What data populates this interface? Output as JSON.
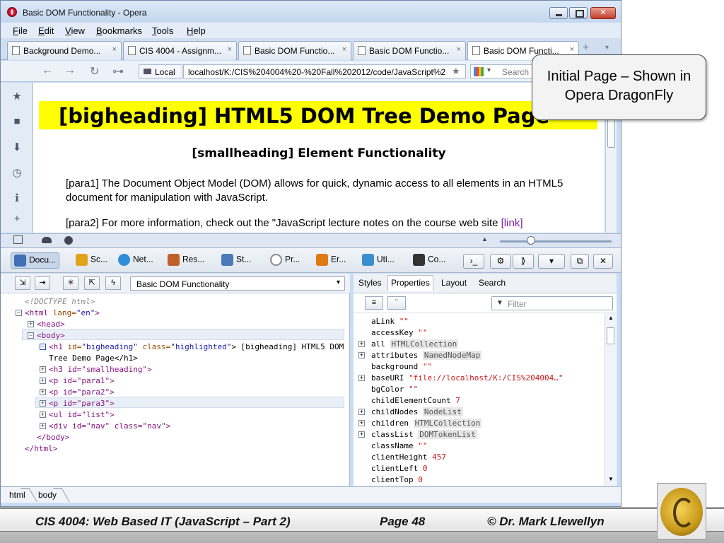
{
  "window": {
    "title": "Basic DOM Functionality - Opera",
    "close_glyph": "✕"
  },
  "menu": [
    "File",
    "Edit",
    "View",
    "Bookmarks",
    "Tools",
    "Help"
  ],
  "tabs": [
    {
      "label": "Background Demo...",
      "close": "×"
    },
    {
      "label": "CIS 4004 - Assignm...",
      "close": "×"
    },
    {
      "label": "Basic DOM Functio...",
      "close": "×"
    },
    {
      "label": "Basic DOM Functio...",
      "close": "×"
    },
    {
      "label": "Basic DOM Functi...",
      "close": "×"
    }
  ],
  "tab_add": "+",
  "tab_menu": "▾",
  "address": {
    "back": "←",
    "forward": "→",
    "reload": "↻",
    "key": "⊶",
    "local_label": "Local",
    "url": "localhost/K:/CIS%204004%20-%20Fall%202012/code/JavaScript%2",
    "star": "★",
    "search_placeholder": "Search",
    "search_arrow": "▾"
  },
  "sidepanel_icons": [
    "★",
    "■",
    "⬇",
    "◷",
    "ℹ",
    "+"
  ],
  "page": {
    "bigheading": "[bigheading] HTML5 DOM Tree Demo Page",
    "smallheading": "[smallheading] Element Functionality",
    "para1": "[para1] The Document Object Model (DOM) allows for quick, dynamic access to all elements in an HTML5 document for manipulation with JavaScript.",
    "para2_text": "[para2] For more information, check out the \"JavaScript lecture notes on the course web site ",
    "para2_link": "[link]"
  },
  "dragonfly": {
    "tabs": [
      "Docu...",
      "Sc...",
      "Net...",
      "Res...",
      "St...",
      "Pr...",
      "Er...",
      "Uti...",
      "Co..."
    ],
    "tab_colors": [
      "#3f6fb5",
      "#e2a21a",
      "#2e8ed8",
      "#c0602a",
      "#4a7ab8",
      "#8a8a8a",
      "#e07a10",
      "#3a8fd0",
      "#333333"
    ],
    "toolbar_buttons": [
      "›_",
      "⚙",
      "⟫",
      "▾",
      "⧉",
      "✕"
    ],
    "dom_select": "Basic DOM Functionality",
    "dom_buttons": [
      "⇲",
      "⇥",
      "✳",
      "⇱",
      "ϟ"
    ],
    "tree": {
      "doctype": "<!DOCTYPE html>",
      "html_open": "<html",
      "lang_attr": " lang=",
      "lang_val": "\"en\"",
      "head": "<head>",
      "body": "<body>",
      "h1_open": "<h1",
      "h1_id": " id=",
      "h1_id_val": "\"bigheading\"",
      "h1_class": " class=",
      "h1_class_val": "\"highlighted\"",
      "h1_text1": "> [bigheading] HTML5 DOM",
      "h1_text2": "Tree Demo Page</h1>",
      "h3": "<h3 id=\"smallheading\">",
      "p1": "<p id=\"para1\">",
      "p2": "<p id=\"para2\">",
      "p3": "<p id=\"para3\">",
      "ul": "<ul id=\"list\">",
      "div": "<div id=\"nav\" class=\"nav\">",
      "body_close": "</body>",
      "html_close": "</html>"
    },
    "props_tabs": [
      "Styles",
      "Properties",
      "Layout",
      "Search"
    ],
    "filter_placeholder": "Filter",
    "properties": [
      {
        "name": "aLink",
        "value": "\"\"",
        "kind": "str",
        "expandable": false
      },
      {
        "name": "accessKey",
        "value": "\"\"",
        "kind": "str",
        "expandable": false
      },
      {
        "name": "all",
        "value": "HTMLCollection",
        "kind": "obj",
        "expandable": true
      },
      {
        "name": "attributes",
        "value": "NamedNodeMap",
        "kind": "obj",
        "expandable": true
      },
      {
        "name": "background",
        "value": "\"\"",
        "kind": "str",
        "expandable": false
      },
      {
        "name": "baseURI",
        "value": "\"file://localhost/K:/CIS%204004…\"",
        "kind": "str",
        "expandable": true
      },
      {
        "name": "bgColor",
        "value": "\"\"",
        "kind": "str",
        "expandable": false
      },
      {
        "name": "childElementCount",
        "value": "7",
        "kind": "num",
        "expandable": false
      },
      {
        "name": "childNodes",
        "value": "NodeList",
        "kind": "obj",
        "expandable": true
      },
      {
        "name": "children",
        "value": "HTMLCollection",
        "kind": "obj",
        "expandable": true
      },
      {
        "name": "classList",
        "value": "DOMTokenList",
        "kind": "obj",
        "expandable": true
      },
      {
        "name": "className",
        "value": "\"\"",
        "kind": "str",
        "expandable": false
      },
      {
        "name": "clientHeight",
        "value": "457",
        "kind": "num",
        "expandable": false
      },
      {
        "name": "clientLeft",
        "value": "0",
        "kind": "num",
        "expandable": false
      },
      {
        "name": "clientTop",
        "value": "0",
        "kind": "num",
        "expandable": false
      }
    ],
    "breadcrumb": [
      "html",
      "body"
    ]
  },
  "callout": "Initial Page – Shown in Opera DragonFly",
  "footer": {
    "course": "CIS 4004: Web Based IT (JavaScript – Part 2)",
    "page": "Page 48",
    "author": "© Dr. Mark Llewellyn"
  }
}
